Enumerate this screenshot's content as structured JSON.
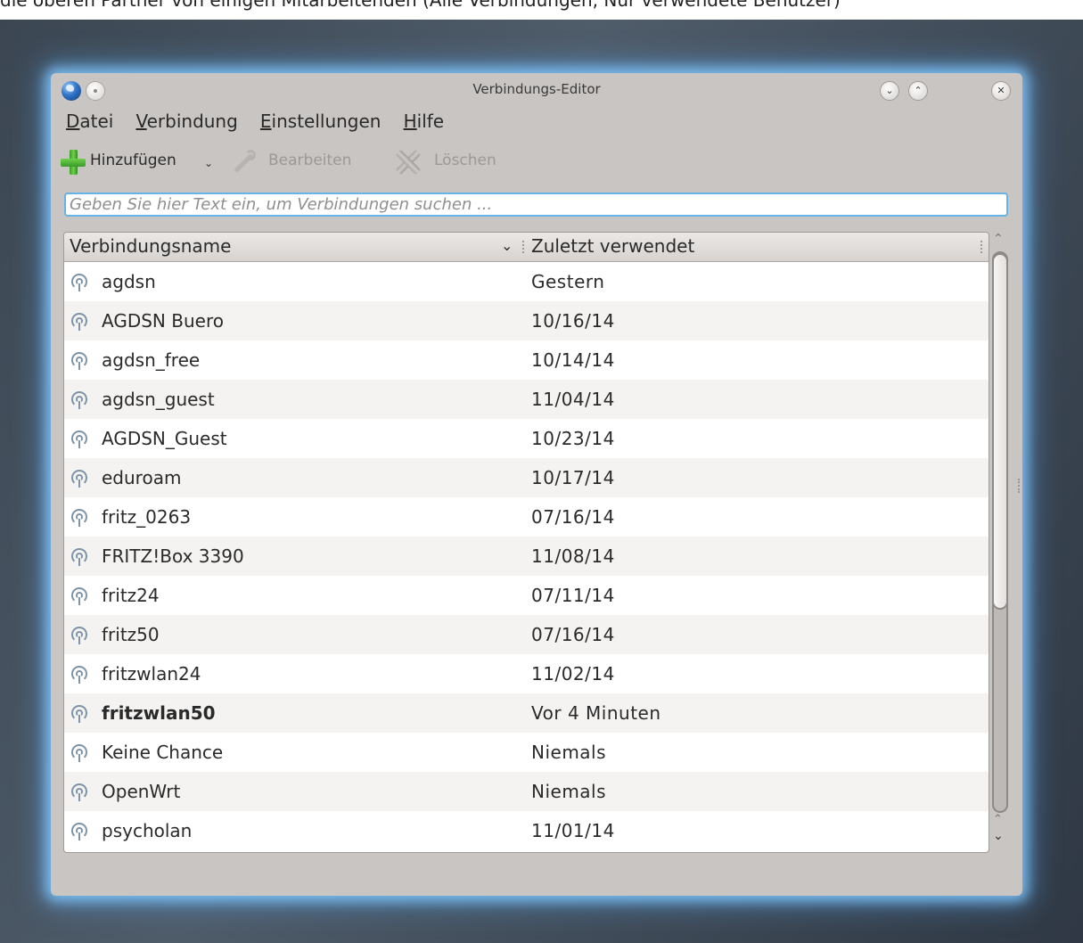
{
  "caption": "die oberen Partner von einigen Mitarbeitenden (Alle Verbindungen, Nur verwendete Benutzer)",
  "window": {
    "title": "Verbindungs-Editor"
  },
  "menu": [
    {
      "label": "Datei",
      "mnemonic": "D",
      "rest": "atei"
    },
    {
      "label": "Verbindung",
      "mnemonic": "V",
      "rest": "erbindung"
    },
    {
      "label": "Einstellungen",
      "mnemonic": "E",
      "rest": "instellungen"
    },
    {
      "label": "Hilfe",
      "mnemonic": "H",
      "rest": "ilfe"
    }
  ],
  "toolbar": {
    "add_label": "Hinzufügen",
    "edit_label": "Bearbeiten",
    "delete_label": "Löschen"
  },
  "search": {
    "placeholder": "Geben Sie hier Text ein, um Verbindungen suchen ..."
  },
  "table": {
    "columns": [
      "Verbindungsname",
      "Zuletzt verwendet"
    ],
    "rows": [
      {
        "name": "agdsn",
        "last_used": "Gestern",
        "active": false
      },
      {
        "name": "AGDSN Buero",
        "last_used": "10/16/14",
        "active": false
      },
      {
        "name": "agdsn_free",
        "last_used": "10/14/14",
        "active": false
      },
      {
        "name": "agdsn_guest",
        "last_used": "11/04/14",
        "active": false
      },
      {
        "name": "AGDSN_Guest",
        "last_used": "10/23/14",
        "active": false
      },
      {
        "name": "eduroam",
        "last_used": "10/17/14",
        "active": false
      },
      {
        "name": "fritz_0263",
        "last_used": "07/16/14",
        "active": false
      },
      {
        "name": "FRITZ!Box 3390",
        "last_used": "11/08/14",
        "active": false
      },
      {
        "name": "fritz24",
        "last_used": "07/11/14",
        "active": false
      },
      {
        "name": "fritz50",
        "last_used": "07/16/14",
        "active": false
      },
      {
        "name": "fritzwlan24",
        "last_used": "11/02/14",
        "active": false
      },
      {
        "name": "fritzwlan50",
        "last_used": "Vor 4 Minuten",
        "active": true
      },
      {
        "name": "Keine Chance",
        "last_used": "Niemals",
        "active": false
      },
      {
        "name": "OpenWrt",
        "last_used": "Niemals",
        "active": false
      },
      {
        "name": "psycholan",
        "last_used": "11/01/14",
        "active": false
      }
    ]
  },
  "icons": {
    "app": "globe-icon",
    "add": "plus-icon",
    "edit": "wrench-icon",
    "delete": "x-icon",
    "row": "wireless-icon"
  },
  "colors": {
    "window_glow": "#82c8ff",
    "search_focus": "#66b3e8",
    "add_icon": "#4fb83a"
  }
}
